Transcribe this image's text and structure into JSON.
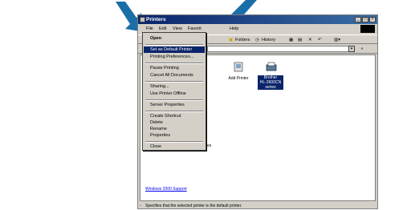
{
  "window": {
    "title": "Printers"
  },
  "menubar": {
    "file": "File",
    "edit": "Edit",
    "view": "View",
    "favorites": "Favorit",
    "help": "Help"
  },
  "toolbar": {
    "folders": "Folders",
    "history": "History"
  },
  "address": {
    "go": " »"
  },
  "content": {
    "add_printer": "Add Printer",
    "brother_line1": "Brother",
    "brother_line2": "HL-2600CN",
    "brother_line3": "series",
    "left_stub": "L",
    "left_stub2": "es",
    "support_link": "Windows 2000 Support"
  },
  "context_menu": {
    "open": "Open",
    "set_default": "Set as Default Printer",
    "printing_prefs": "Printing Preferences...",
    "pause": "Pause Printing",
    "cancel_all": "Cancel All Documents",
    "sharing": "Sharing...",
    "use_offline": "Use Printer Offline",
    "server_props": "Server Properties",
    "create_shortcut": "Create Shortcut",
    "delete": "Delete",
    "rename": "Rename",
    "properties": "Properties",
    "close": "Close"
  },
  "statusbar": {
    "text": "Specifies that the selected printer is the default printer."
  },
  "colors": {
    "arrow": "#1a6ea8",
    "highlight": "#0a246a",
    "titlebar": "#0a246a"
  }
}
